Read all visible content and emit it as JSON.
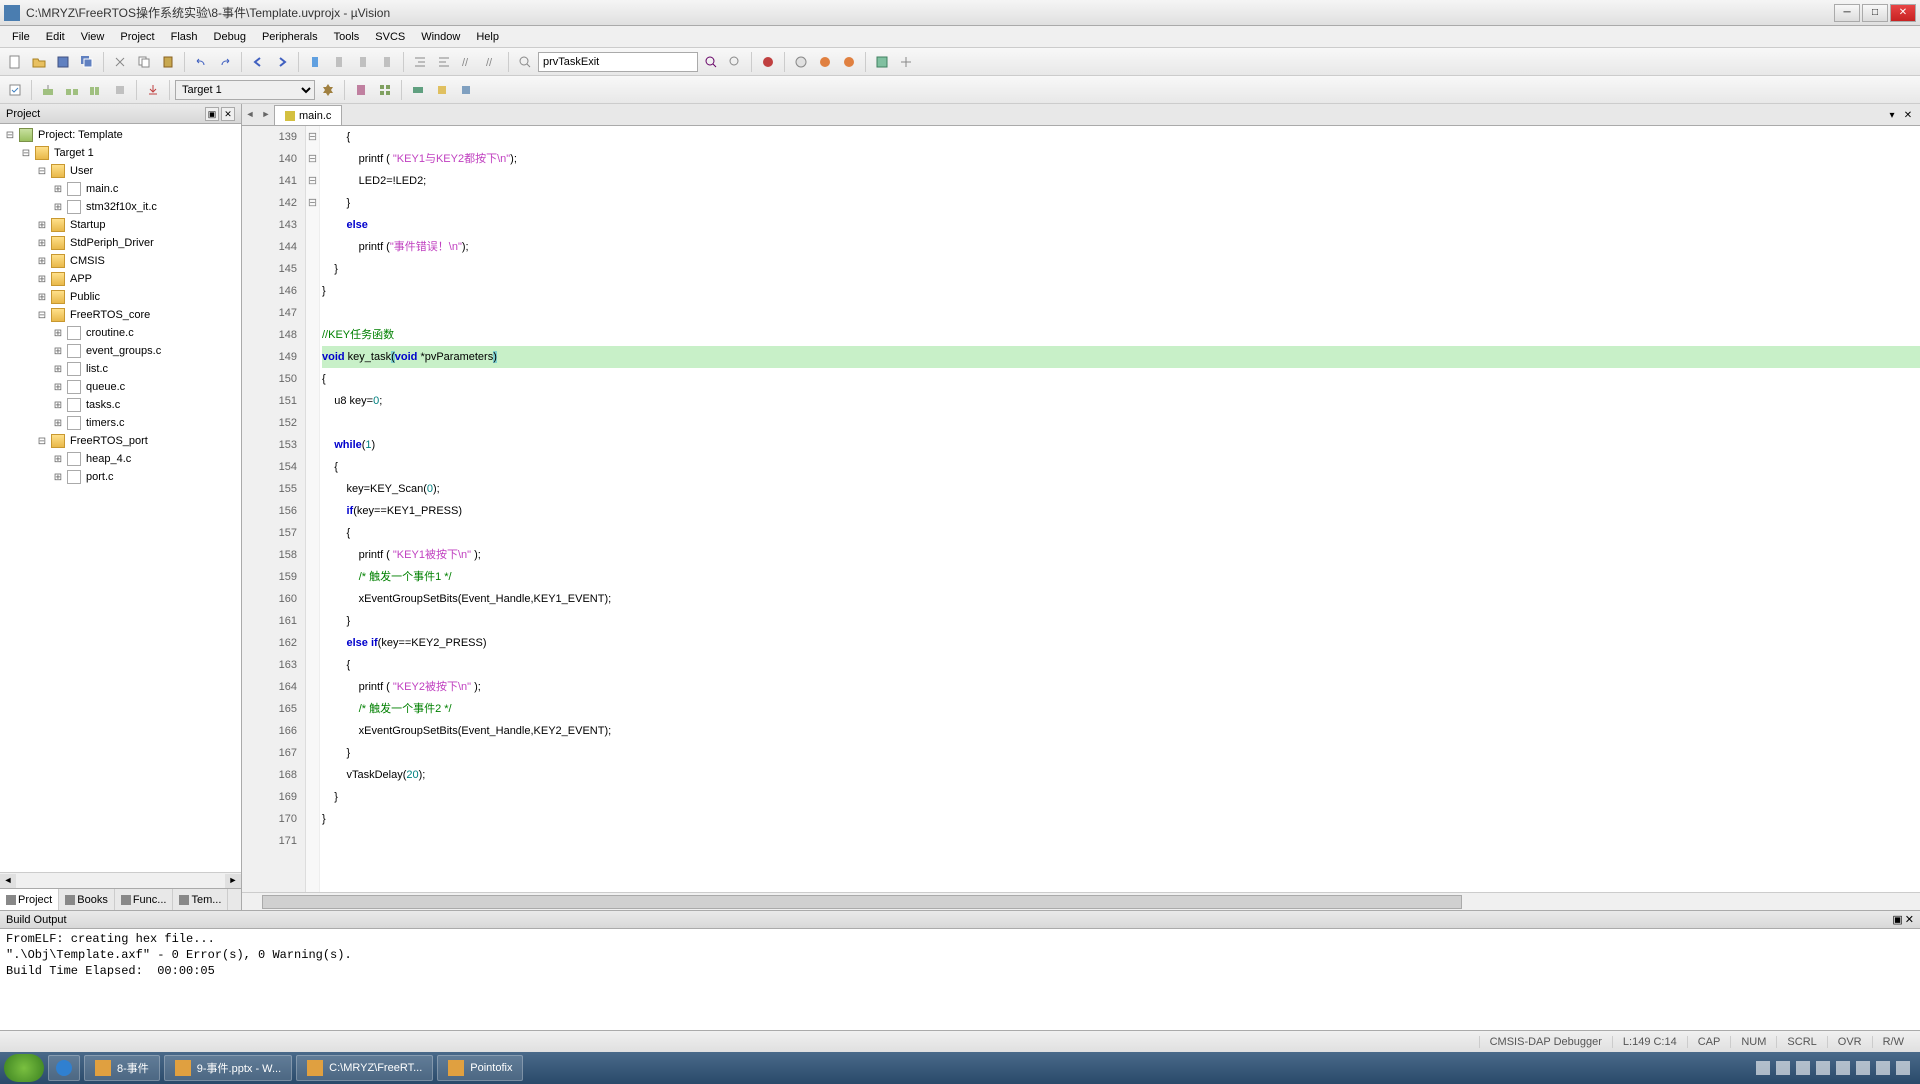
{
  "window": {
    "title": "C:\\MRYZ\\FreeRTOS操作系统实验\\8-事件\\Template.uvprojx - µVision"
  },
  "menu": [
    "File",
    "Edit",
    "View",
    "Project",
    "Flash",
    "Debug",
    "Peripherals",
    "Tools",
    "SVCS",
    "Window",
    "Help"
  ],
  "toolbar1": {
    "find_value": "prvTaskExit"
  },
  "toolbar2": {
    "target_value": "Target 1"
  },
  "project_panel": {
    "title": "Project",
    "root": "Project: Template",
    "target": "Target 1",
    "groups": [
      {
        "name": "User",
        "files": [
          "main.c",
          "stm32f10x_it.c"
        ],
        "expanded": true
      },
      {
        "name": "Startup",
        "files": [],
        "expanded": false
      },
      {
        "name": "StdPeriph_Driver",
        "files": [],
        "expanded": false
      },
      {
        "name": "CMSIS",
        "files": [],
        "expanded": false
      },
      {
        "name": "APP",
        "files": [],
        "expanded": false
      },
      {
        "name": "Public",
        "files": [],
        "expanded": false
      },
      {
        "name": "FreeRTOS_core",
        "files": [
          "croutine.c",
          "event_groups.c",
          "list.c",
          "queue.c",
          "tasks.c",
          "timers.c"
        ],
        "expanded": true
      },
      {
        "name": "FreeRTOS_port",
        "files": [
          "heap_4.c",
          "port.c"
        ],
        "expanded": true
      }
    ],
    "tabs": [
      "Project",
      "Books",
      "Func...",
      "Tem..."
    ]
  },
  "editor": {
    "active_tab": "main.c",
    "first_line": 139,
    "lines": [
      {
        "indent": 8,
        "tokens": [
          {
            "t": "{",
            "c": ""
          }
        ]
      },
      {
        "indent": 12,
        "tokens": [
          {
            "t": "printf ( ",
            "c": ""
          },
          {
            "t": "\"KEY1与KEY2都按下\\n\"",
            "c": "str"
          },
          {
            "t": ");",
            "c": ""
          }
        ]
      },
      {
        "indent": 12,
        "tokens": [
          {
            "t": "LED2=!LED2;",
            "c": ""
          }
        ]
      },
      {
        "indent": 8,
        "tokens": [
          {
            "t": "}",
            "c": ""
          }
        ]
      },
      {
        "indent": 8,
        "tokens": [
          {
            "t": "else",
            "c": "kw"
          }
        ]
      },
      {
        "indent": 12,
        "tokens": [
          {
            "t": "printf (",
            "c": ""
          },
          {
            "t": "\"事件错误！\\n\"",
            "c": "str"
          },
          {
            "t": ");",
            "c": ""
          }
        ]
      },
      {
        "indent": 4,
        "tokens": [
          {
            "t": "}",
            "c": ""
          }
        ]
      },
      {
        "indent": 0,
        "tokens": [
          {
            "t": "}",
            "c": ""
          }
        ]
      },
      {
        "indent": 0,
        "tokens": []
      },
      {
        "indent": 0,
        "tokens": [
          {
            "t": "//KEY任务函数",
            "c": "cmt"
          }
        ]
      },
      {
        "indent": 0,
        "hl": true,
        "tokens": [
          {
            "t": "void",
            "c": "kw"
          },
          {
            "t": " key_task",
            "c": ""
          },
          {
            "t": "(",
            "c": "paren-hl"
          },
          {
            "t": "void",
            "c": "kw"
          },
          {
            "t": " *pvParameters",
            "c": ""
          },
          {
            "t": ")",
            "c": "paren-hl"
          }
        ]
      },
      {
        "indent": 0,
        "tokens": [
          {
            "t": "{",
            "c": ""
          }
        ]
      },
      {
        "indent": 4,
        "tokens": [
          {
            "t": "u8 key=",
            "c": ""
          },
          {
            "t": "0",
            "c": "num"
          },
          {
            "t": ";",
            "c": ""
          }
        ]
      },
      {
        "indent": 4,
        "tokens": []
      },
      {
        "indent": 4,
        "tokens": [
          {
            "t": "while",
            "c": "kw"
          },
          {
            "t": "(",
            "c": ""
          },
          {
            "t": "1",
            "c": "num"
          },
          {
            "t": ")",
            "c": ""
          }
        ]
      },
      {
        "indent": 4,
        "tokens": [
          {
            "t": "{",
            "c": ""
          }
        ]
      },
      {
        "indent": 8,
        "tokens": [
          {
            "t": "key=KEY_Scan(",
            "c": ""
          },
          {
            "t": "0",
            "c": "num"
          },
          {
            "t": ");",
            "c": ""
          }
        ]
      },
      {
        "indent": 8,
        "tokens": [
          {
            "t": "if",
            "c": "kw"
          },
          {
            "t": "(key==KEY1_PRESS)",
            "c": ""
          }
        ]
      },
      {
        "indent": 8,
        "tokens": [
          {
            "t": "{",
            "c": ""
          }
        ]
      },
      {
        "indent": 12,
        "tokens": [
          {
            "t": "printf ( ",
            "c": ""
          },
          {
            "t": "\"KEY1被按下\\n\"",
            "c": "str"
          },
          {
            "t": " );",
            "c": ""
          }
        ]
      },
      {
        "indent": 12,
        "tokens": [
          {
            "t": "/* 触发一个事件1 */",
            "c": "cmt"
          }
        ]
      },
      {
        "indent": 12,
        "tokens": [
          {
            "t": "xEventGroupSetBits(Event_Handle,KEY1_EVENT);",
            "c": ""
          }
        ]
      },
      {
        "indent": 8,
        "tokens": [
          {
            "t": "}",
            "c": ""
          }
        ]
      },
      {
        "indent": 8,
        "tokens": [
          {
            "t": "else",
            "c": "kw"
          },
          {
            "t": " ",
            "c": ""
          },
          {
            "t": "if",
            "c": "kw"
          },
          {
            "t": "(key==KEY2_PRESS)",
            "c": ""
          }
        ]
      },
      {
        "indent": 8,
        "tokens": [
          {
            "t": "{",
            "c": ""
          }
        ]
      },
      {
        "indent": 12,
        "tokens": [
          {
            "t": "printf ( ",
            "c": ""
          },
          {
            "t": "\"KEY2被按下\\n\"",
            "c": "str"
          },
          {
            "t": " );",
            "c": ""
          }
        ]
      },
      {
        "indent": 12,
        "tokens": [
          {
            "t": "/* 触发一个事件2 */",
            "c": "cmt"
          }
        ]
      },
      {
        "indent": 12,
        "tokens": [
          {
            "t": "xEventGroupSetBits(Event_Handle,KEY2_EVENT);",
            "c": ""
          }
        ]
      },
      {
        "indent": 8,
        "tokens": [
          {
            "t": "}",
            "c": ""
          }
        ]
      },
      {
        "indent": 8,
        "tokens": [
          {
            "t": "vTaskDelay(",
            "c": ""
          },
          {
            "t": "20",
            "c": "num"
          },
          {
            "t": ");",
            "c": ""
          }
        ]
      },
      {
        "indent": 4,
        "tokens": [
          {
            "t": "}",
            "c": ""
          }
        ]
      },
      {
        "indent": 0,
        "tokens": [
          {
            "t": "}",
            "c": ""
          }
        ]
      },
      {
        "indent": 0,
        "tokens": []
      }
    ],
    "fold_marks": {
      "150": "⊟",
      "154": "⊟",
      "157": "⊟",
      "163": "⊟"
    }
  },
  "build_output": {
    "title": "Build Output",
    "lines": [
      "FromELF: creating hex file...",
      "\".\\Obj\\Template.axf\" - 0 Error(s), 0 Warning(s).",
      "Build Time Elapsed:  00:00:05"
    ]
  },
  "status": {
    "debugger": "CMSIS-DAP Debugger",
    "pos": "L:149 C:14",
    "caps": "CAP",
    "num": "NUM",
    "scrl": "SCRL",
    "ovr": "OVR",
    "rw": "R/W"
  },
  "taskbar": {
    "items": [
      {
        "label": "8-事件"
      },
      {
        "label": "9-事件.pptx - W..."
      },
      {
        "label": "C:\\MRYZ\\FreeRT..."
      },
      {
        "label": "Pointofix"
      }
    ]
  }
}
